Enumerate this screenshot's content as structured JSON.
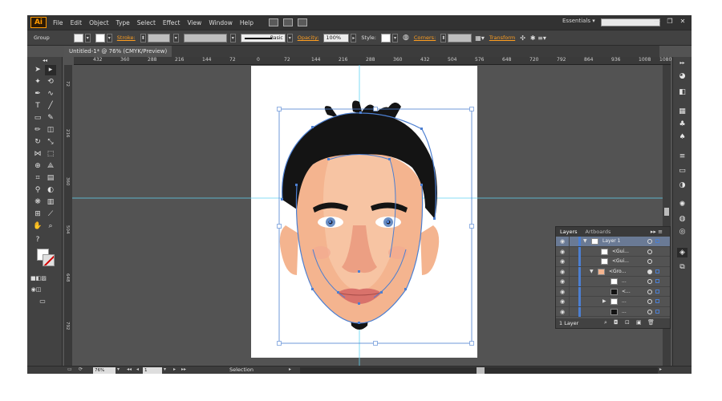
{
  "app": {
    "logo": "Ai",
    "workspace": "Essentials ▾",
    "window_controls": [
      "—",
      "❐",
      "✕"
    ]
  },
  "menu": [
    "File",
    "Edit",
    "Object",
    "Type",
    "Select",
    "Effect",
    "View",
    "Window",
    "Help"
  ],
  "control_bar": {
    "selection_type": "Group",
    "stroke_label": "Stroke:",
    "stroke_style": "Basic",
    "opacity_label": "Opacity:",
    "opacity_value": "100%",
    "style_label": "Style:",
    "corners_label": "Corners:",
    "transform_label": "Transform"
  },
  "document": {
    "tab_title": "Untitled-1* @ 76% (CMYK/Preview)",
    "close": "✕"
  },
  "ruler_ticks": [
    "432",
    "360",
    "288",
    "216",
    "144",
    "72",
    "0",
    "72",
    "144",
    "216",
    "288",
    "360",
    "432",
    "504",
    "576",
    "648",
    "720",
    "792",
    "864",
    "936",
    "1008",
    "1080"
  ],
  "layers_panel": {
    "tabs": [
      "Layers",
      "Artboards"
    ],
    "rows": [
      {
        "name": "Layer 1",
        "level": 0,
        "expanded": true,
        "selected": true
      },
      {
        "name": "<Gui...",
        "level": 2,
        "expanded": false,
        "selected": false
      },
      {
        "name": "<Gui...",
        "level": 2,
        "expanded": false,
        "selected": false
      },
      {
        "name": "<Gro...",
        "level": 1,
        "expanded": true,
        "selected": false
      },
      {
        "name": "...",
        "level": 2,
        "expanded": false,
        "selected": false
      },
      {
        "name": "<...",
        "level": 2,
        "expanded": false,
        "selected": false
      },
      {
        "name": "...",
        "level": 2,
        "expanded": false,
        "selected": false
      },
      {
        "name": "...",
        "level": 2,
        "expanded": false,
        "selected": false
      }
    ],
    "footer_count": "1 Layer"
  },
  "status_bar": {
    "zoom": "76%",
    "page": "1",
    "mode": "Selection"
  },
  "colors": {
    "app_bg": "#535353",
    "panel_bg": "#424242",
    "accent": "#ff9e1f",
    "selection": "#4c7fd1",
    "guide": "#5fd3f3",
    "skin": "#f4b48f",
    "hair": "#141414",
    "lips": "#d9726b"
  },
  "tools": [
    "selection-tool",
    "direct-selection-tool",
    "magic-wand-tool",
    "lasso-tool",
    "pen-tool",
    "curvature-tool",
    "type-tool",
    "line-tool",
    "rectangle-tool",
    "paintbrush-tool",
    "pencil-tool",
    "eraser-tool",
    "rotate-tool",
    "scale-tool",
    "width-tool",
    "free-transform-tool",
    "shape-builder-tool",
    "perspective-grid-tool",
    "mesh-tool",
    "gradient-tool",
    "eyedropper-tool",
    "blend-tool",
    "symbol-sprayer-tool",
    "column-graph-tool",
    "artboard-tool",
    "slice-tool",
    "hand-tool",
    "zoom-tool"
  ]
}
